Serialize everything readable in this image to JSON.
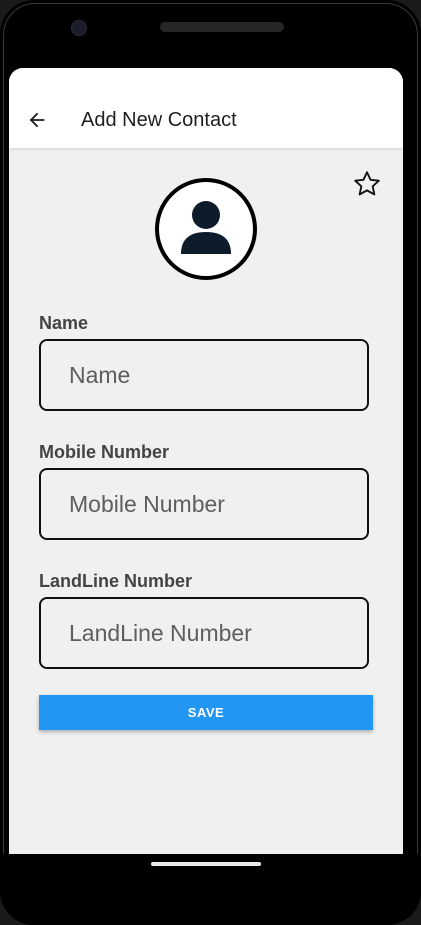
{
  "appbar": {
    "title": "Add New Contact",
    "back_icon": "arrow-left-icon"
  },
  "favorite_icon": "star-outline-icon",
  "avatar_icon": "person-icon",
  "form": {
    "name": {
      "label": "Name",
      "value": "",
      "placeholder": "Name"
    },
    "mobile": {
      "label": "Mobile Number",
      "value": "",
      "placeholder": "Mobile Number"
    },
    "landline": {
      "label": "LandLine Number",
      "value": "",
      "placeholder": "LandLine Number"
    }
  },
  "save_label": "SAVE",
  "colors": {
    "accent": "#2196f3",
    "background": "#f0f0f0",
    "appbar": "#ffffff"
  }
}
